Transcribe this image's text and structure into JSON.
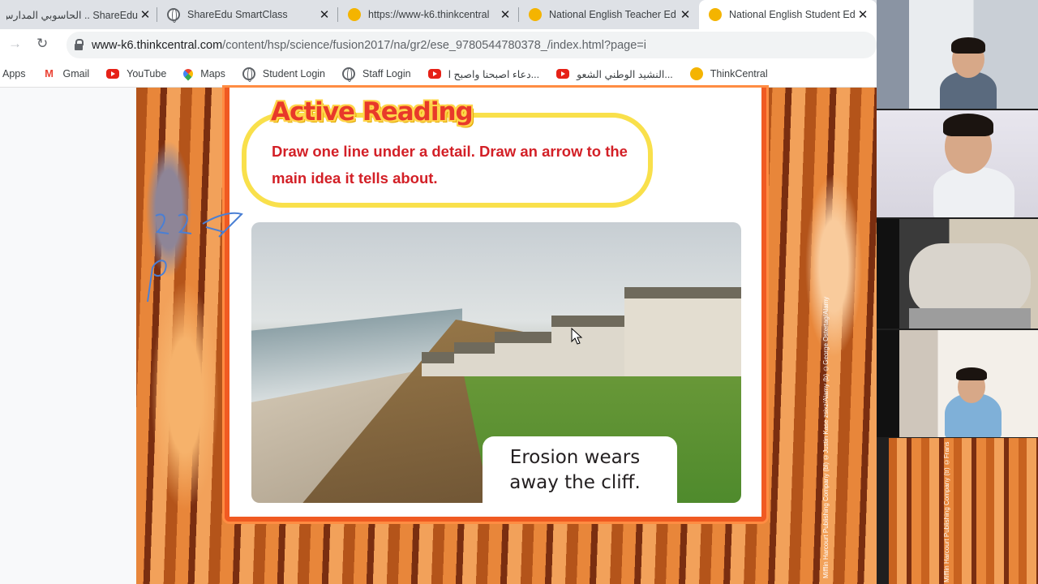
{
  "tabs": [
    {
      "title": "ShareEdu .. الحاسوبي المدارس",
      "icon": "shareedu-favicon",
      "active": false
    },
    {
      "title": "ShareEdu SmartClass",
      "icon": "globe-icon",
      "active": false
    },
    {
      "title": "https://www-k6.thinkcentral",
      "icon": "thinkcentral-favicon",
      "active": false
    },
    {
      "title": "National English Teacher Ed",
      "icon": "thinkcentral-favicon",
      "active": false
    },
    {
      "title": "National English Student Ed",
      "icon": "thinkcentral-favicon",
      "active": true
    }
  ],
  "address": {
    "host": "www-k6.thinkcentral.com",
    "path": "/content/hsp/science/fusion2017/na/gr2/ese_9780544780378_/index.html?page=i"
  },
  "bookmarks": [
    {
      "label": "Apps",
      "icon": "apps-grid-icon"
    },
    {
      "label": "Gmail",
      "icon": "gmail-icon"
    },
    {
      "label": "YouTube",
      "icon": "youtube-icon"
    },
    {
      "label": "Maps",
      "icon": "maps-icon"
    },
    {
      "label": "Student Login",
      "icon": "globe-icon"
    },
    {
      "label": "Staff Login",
      "icon": "globe-icon"
    },
    {
      "label": "دعاء اصبحنا واصبح ا...",
      "icon": "youtube-icon"
    },
    {
      "label": "النشيد الوطني الشعو...",
      "icon": "youtube-icon"
    },
    {
      "label": "ThinkCentral",
      "icon": "thinkcentral-favicon"
    }
  ],
  "lesson": {
    "heading": "Active Reading",
    "instruction": "Draw one line under a detail. Draw an arrow to the main idea it tells about.",
    "caption_line1": "Erosion wears",
    "caption_line2": "away the cliff.",
    "photo_credit": "Mifflin Harcourt Publishing Company   (bl) ©Justin Kase zsixz/Alamy (b) ©George Ostertag/Alamy",
    "strip_credit": "Mifflin Harcourt Publishing Company   (tr) ©Frans"
  },
  "colors": {
    "heading": "#e8392a",
    "instruction": "#d32027",
    "callout_border": "#f9e04b",
    "frame": "#f05a22"
  }
}
